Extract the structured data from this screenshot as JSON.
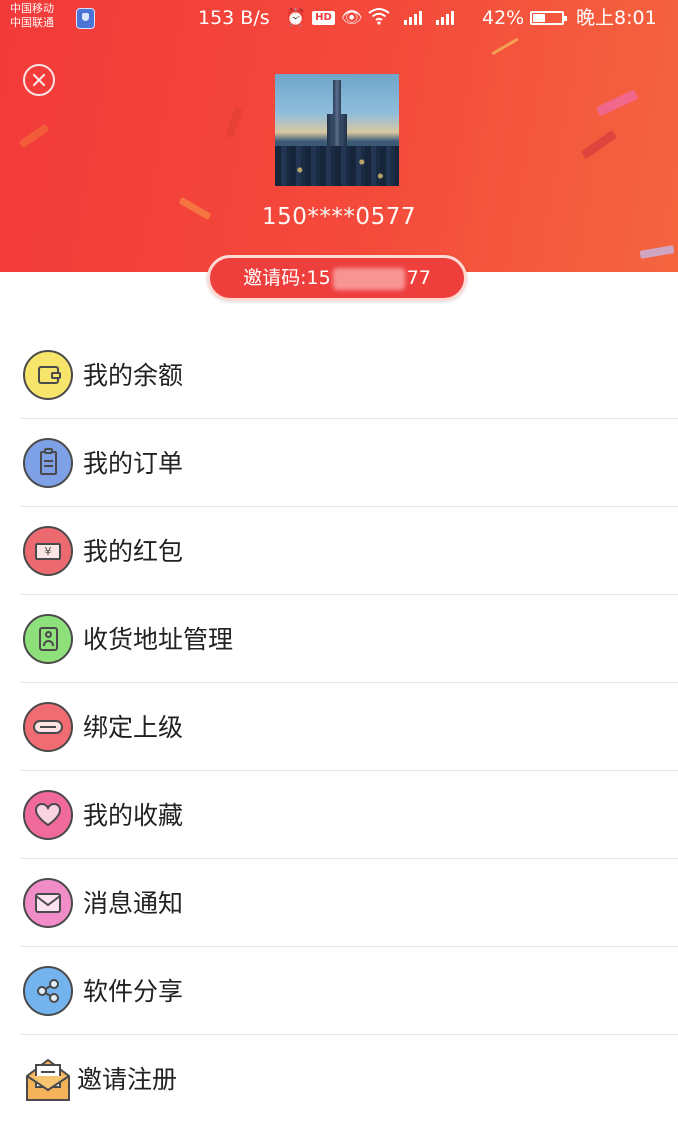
{
  "status_bar": {
    "carrier_1": "中国移动",
    "carrier_2": "中国联通",
    "net_speed": "153 B/s",
    "hd": "HD",
    "battery_pct": "42%",
    "time": "晚上8:01"
  },
  "profile": {
    "phone": "150****0577",
    "invite_prefix": "邀请码:15",
    "invite_suffix": "77"
  },
  "menu": {
    "balance": "我的余额",
    "orders": "我的订单",
    "red_packet": "我的红包",
    "address": "收货地址管理",
    "bind_superior": "绑定上级",
    "favorites": "我的收藏",
    "notifications": "消息通知",
    "share": "软件分享",
    "invite_register": "邀请注册"
  },
  "icons": {
    "close": "close-icon",
    "balance": "wallet-icon",
    "orders": "order-clipboard-icon",
    "red_packet": "red-packet-icon",
    "address": "address-card-icon",
    "bind_superior": "link-icon",
    "favorites": "heart-icon",
    "notifications": "envelope-icon",
    "share": "share-icon",
    "invite_register": "invitation-envelope-icon"
  },
  "colors": {
    "header_red": "#f23a3a",
    "pill_red": "#ee3f3d",
    "balance_icon": "#f7e46a",
    "orders_icon": "#7ea0e6",
    "red_packet_icon": "#ec6a6f",
    "address_icon": "#8ee07b",
    "bind_icon": "#f16c72",
    "favorites_icon": "#f06a9c",
    "notifications_icon": "#f08cc8",
    "share_icon": "#74b4ee"
  }
}
